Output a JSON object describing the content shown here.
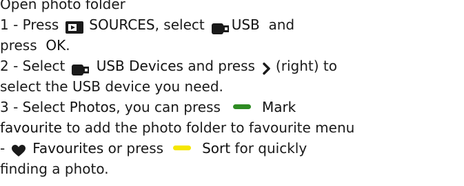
{
  "heading": "Open photo folder",
  "step1": {
    "prefix": "1 -  Press",
    "sources_label": "SOURCES",
    "mid": ", select",
    "usb_label": "USB",
    "tail": "and",
    "cont": "press",
    "ok_label": "OK",
    "end": "."
  },
  "step2": {
    "prefix": "2 -  Select",
    "usb_devices_label": "USB Devices",
    "mid": "and press",
    "right": "(right) to",
    "cont": "select the USB device you need."
  },
  "step3": {
    "prefix": "3 -  Select",
    "photos_label": "Photos",
    "mid": ", you can press",
    "mark_label": "Mark",
    "favourite_label": "favourite",
    "tail": "to add the photo folder to favourite menu",
    "dash": "-",
    "favourites_label": "Favourites",
    "or_press": "or press",
    "sort_label": "Sort",
    "sort_tail": "for quickly",
    "end": "finding a photo."
  },
  "colors": {
    "green_key": "#2e8b23",
    "yellow_key": "#f5e600",
    "text": "#1a1a1a"
  },
  "icons": {
    "sources": "sources-icon",
    "usb": "usb-icon",
    "right_arrow": "chevron-right-icon",
    "favourites": "heart-icon"
  }
}
